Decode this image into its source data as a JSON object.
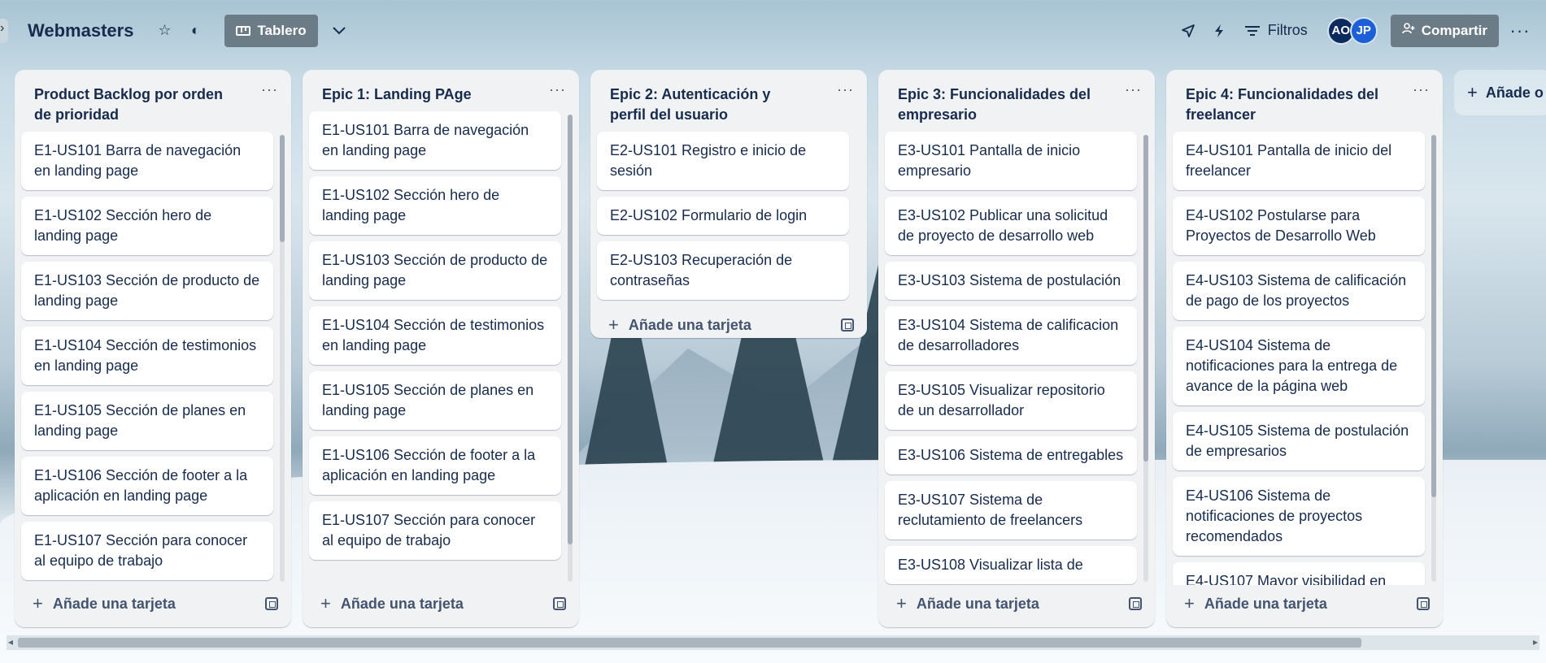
{
  "board": {
    "title": "Webmasters",
    "view_label": "Tablero",
    "filters_label": "Filtros",
    "share_label": "Compartir",
    "members": [
      "AO",
      "JP"
    ]
  },
  "add_card_label": "Añade una tarjeta",
  "add_list_label": "Añade o",
  "lists": [
    {
      "title": "Product Backlog por orden de prioridad",
      "cards": [
        "E1-US101 Barra de navegación en landing page",
        "E1-US102 Sección hero de landing page",
        "E1-US103 Sección de producto de landing page",
        "E1-US104 Sección de testimonios en landing page",
        "E1-US105 Sección de planes en landing page",
        "E1-US106 Sección de footer a la aplicación en landing page",
        "E1-US107 Sección para conocer al equipo de trabajo"
      ],
      "scroll_fraction": 0.24
    },
    {
      "title": "Epic 1: Landing PAge",
      "cards": [
        "E1-US101 Barra de navegación en landing page",
        "E1-US102 Sección hero de landing page",
        "E1-US103 Sección de producto de landing page",
        "E1-US104 Sección de testimonios en landing page",
        "E1-US105 Sección de planes en landing page",
        "E1-US106 Sección de footer a la aplicación en landing page",
        "E1-US107 Sección para conocer al equipo de trabajo"
      ],
      "scroll_fraction": 0.92
    },
    {
      "title": "Epic 2: Autenticación y perfil del usuario",
      "cards": [
        "E2-US101 Registro e inicio de sesión",
        "E2-US102 Formulario de login",
        "E2-US103 Recuperación de contraseñas"
      ]
    },
    {
      "title": "Epic 3: Funcionalidades del empresario",
      "cards": [
        "E3-US101 Pantalla de inicio empresario",
        "E3-US102 Publicar una solicitud de proyecto de desarrollo web",
        "E3-US103 Sistema de postulación",
        "E3-US104 Sistema de calificacion de desarrolladores",
        "E3-US105 Visualizar repositorio de un desarrollador",
        "E3-US106 Sistema de entregables",
        "E3-US107 Sistema de reclutamiento de freelancers",
        "E3-US108 Visualizar lista de"
      ],
      "scroll_fraction": 0.73
    },
    {
      "title": "Epic 4: Funcionalidades del freelancer",
      "cards": [
        "E4-US101 Pantalla de inicio del freelancer",
        "E4-US102 Postularse para Proyectos de Desarrollo Web",
        "E4-US103 Sistema de calificación de pago de los proyectos",
        "E4-US104 Sistema de notificaciones para la entrega de avance de la página web",
        "E4-US105 Sistema de postulación de empresarios",
        "E4-US106 Sistema de notificaciones de proyectos recomendados",
        "E4-US107 Mayor visibilidad en"
      ],
      "scroll_fraction": 0.81
    }
  ]
}
